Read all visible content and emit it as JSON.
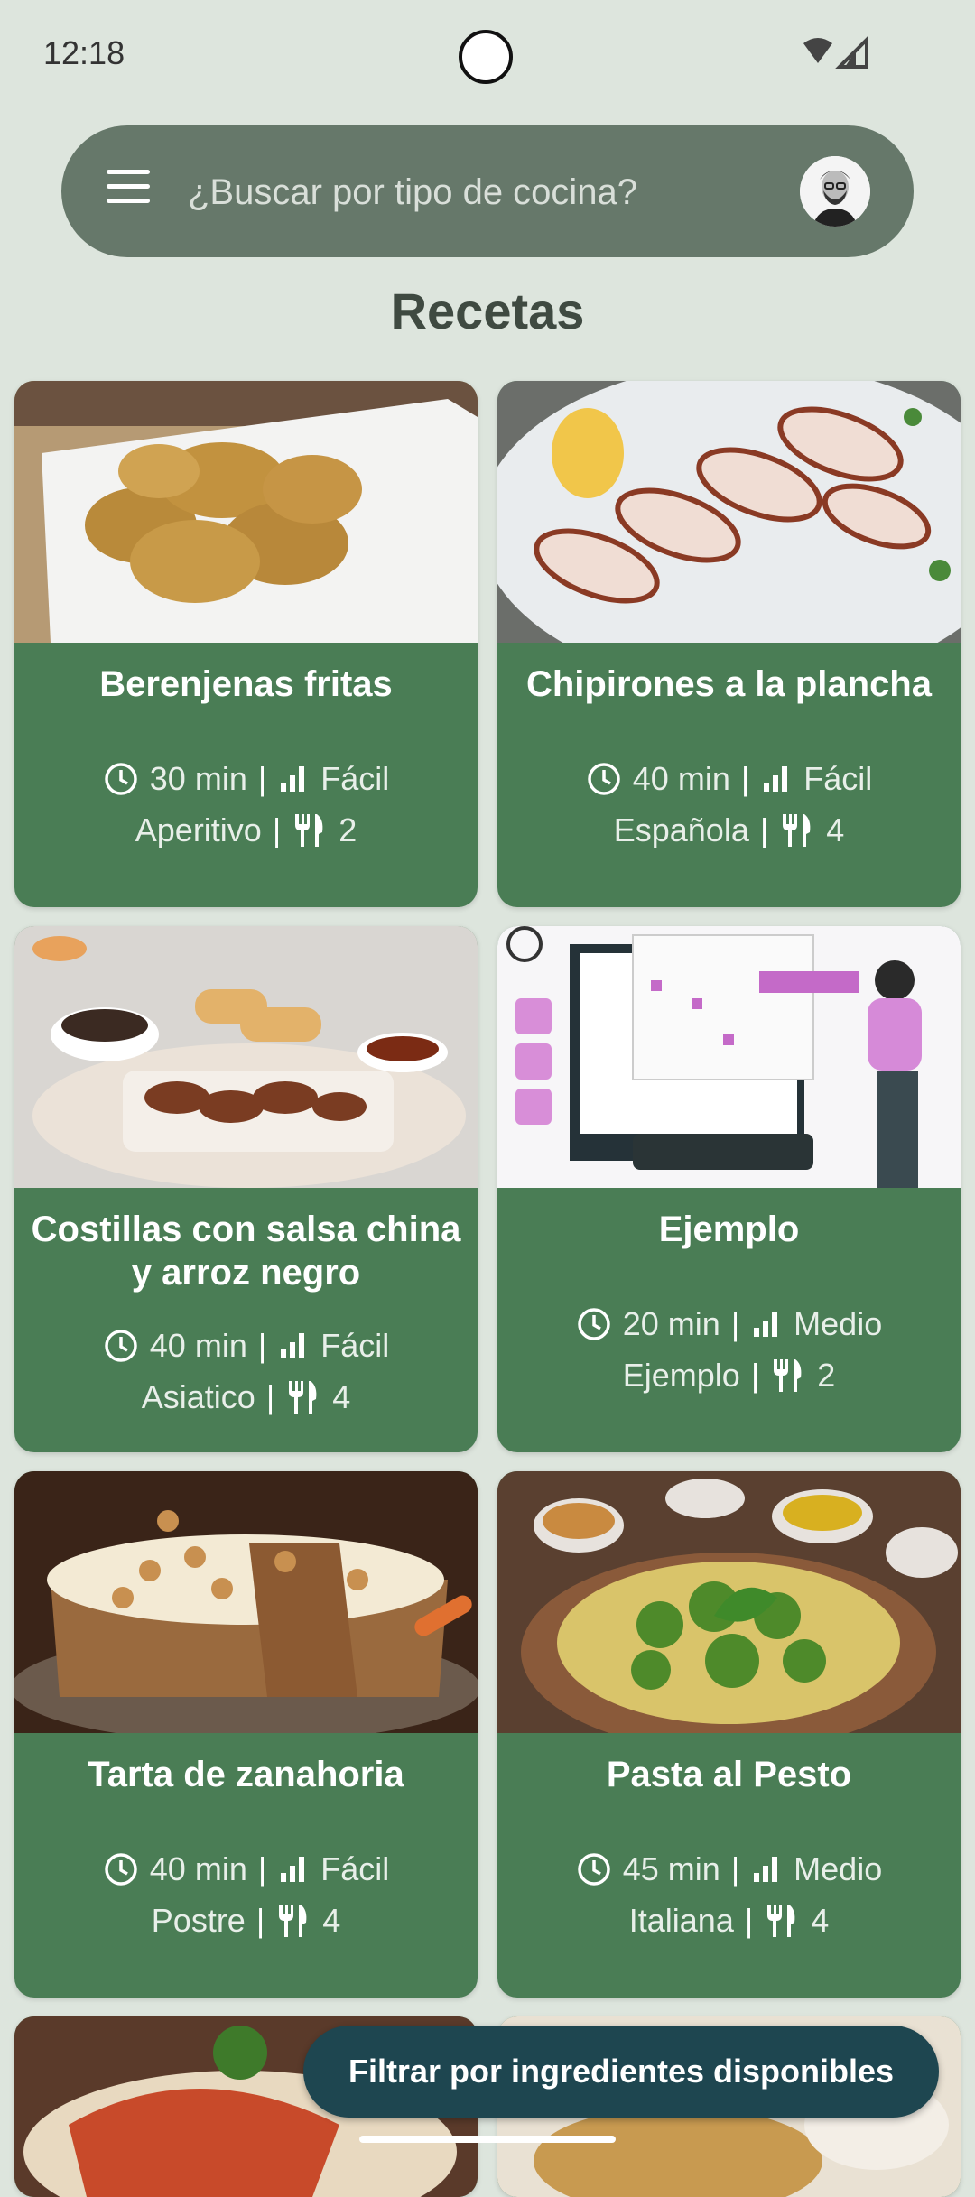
{
  "status": {
    "time": "12:18"
  },
  "search": {
    "placeholder": "¿Buscar por tipo de cocina?"
  },
  "page": {
    "title": "Recetas"
  },
  "recipes": [
    {
      "title": "Berenjenas fritas",
      "time": "30 min",
      "difficulty": "Fácil",
      "category": "Aperitivo",
      "servings": "2"
    },
    {
      "title": "Chipirones a la plancha",
      "time": "40 min",
      "difficulty": "Fácil",
      "category": "Española",
      "servings": "4"
    },
    {
      "title": "Costillas con salsa china y arroz negro",
      "time": "40 min",
      "difficulty": "Fácil",
      "category": "Asiatico",
      "servings": "4"
    },
    {
      "title": "Ejemplo",
      "time": "20 min",
      "difficulty": "Medio",
      "category": "Ejemplo",
      "servings": "2"
    },
    {
      "title": "Tarta de zanahoria",
      "time": "40 min",
      "difficulty": "Fácil",
      "category": "Postre",
      "servings": "4"
    },
    {
      "title": "Pasta al Pesto",
      "time": "45 min",
      "difficulty": "Medio",
      "category": "Italiana",
      "servings": "4"
    }
  ],
  "fab": {
    "label": "Filtrar por ingredientes disponibles"
  },
  "colors": {
    "card": "#4a7d55",
    "searchbar": "#66786a",
    "fab": "#1e4650",
    "background": "#dde5dd"
  },
  "icons": [
    "menu-icon",
    "avatar",
    "clock-icon",
    "difficulty-icon",
    "servings-icon",
    "wifi-icon",
    "signal-icon"
  ]
}
